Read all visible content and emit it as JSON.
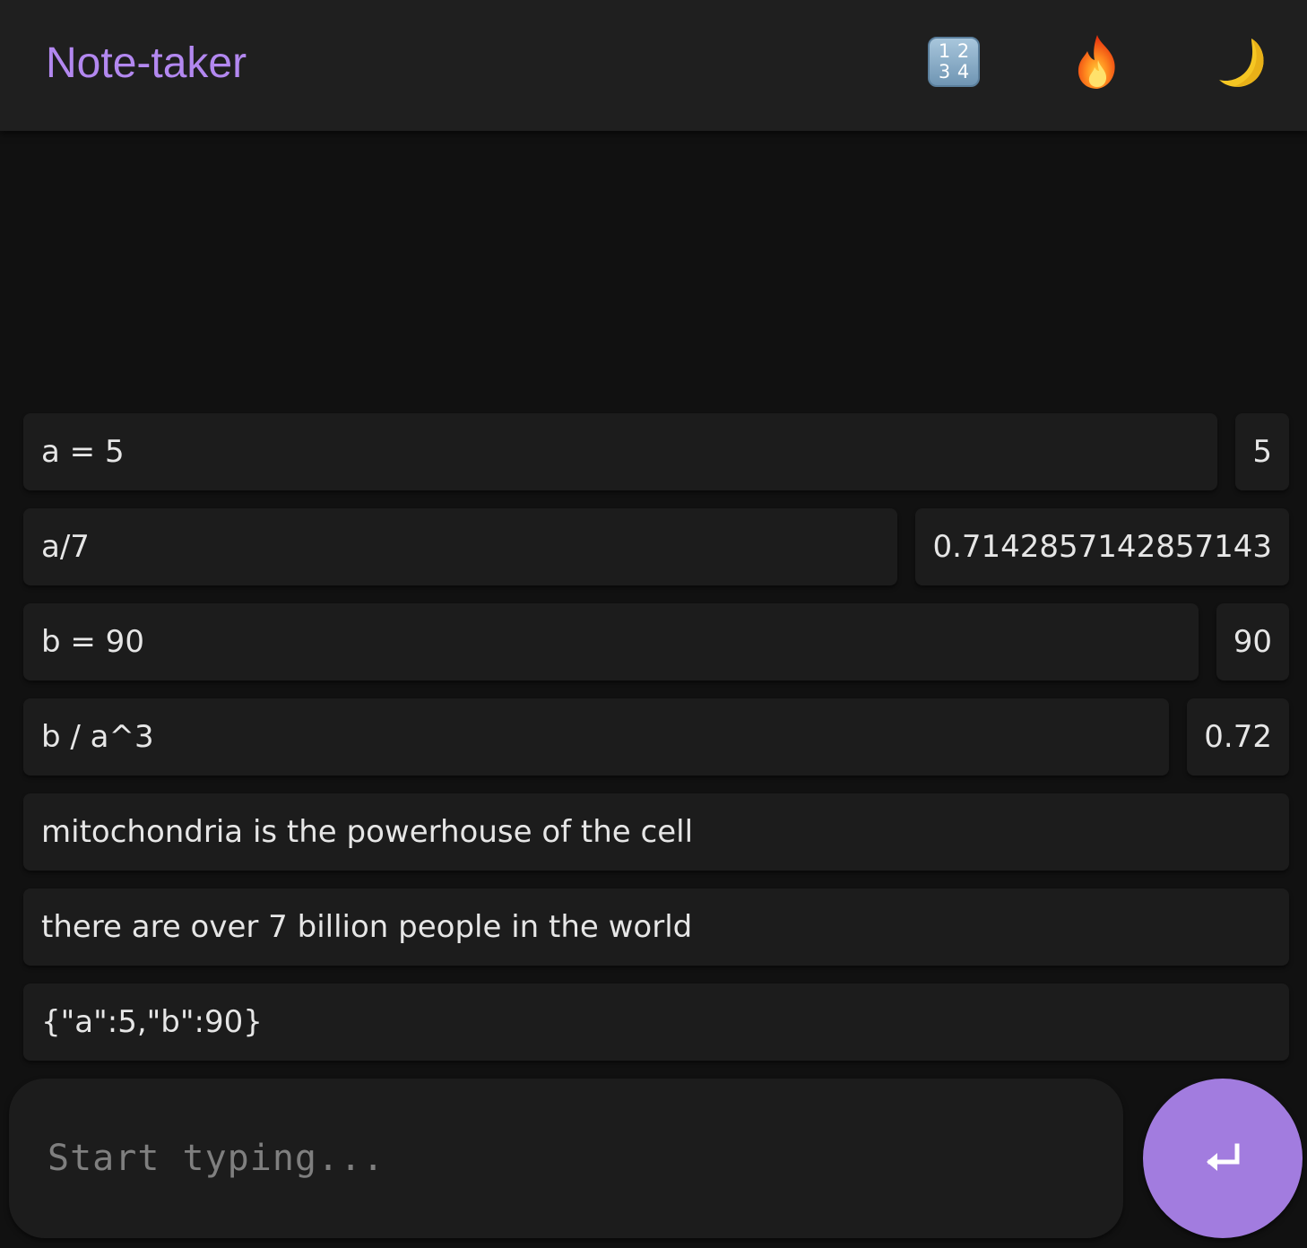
{
  "header": {
    "title": "Note-taker",
    "buttons": [
      {
        "icon": "input-numbers-icon",
        "digits": [
          "1",
          "2",
          "3",
          "4"
        ]
      },
      {
        "icon": "fire-icon"
      },
      {
        "icon": "crescent-moon-icon"
      }
    ]
  },
  "colors": {
    "accent": "#b388f0",
    "send_button": "#a27cdf",
    "background": "#111111",
    "header": "#1f1f1f",
    "cell": "#1c1c1c"
  },
  "notes": [
    {
      "expression": "a = 5",
      "result": "5"
    },
    {
      "expression": "a/7",
      "result": "0.7142857142857143"
    },
    {
      "expression": "b = 90",
      "result": "90"
    },
    {
      "expression": "b / a^3",
      "result": "0.72"
    },
    {
      "expression": "mitochondria is the powerhouse of the cell"
    },
    {
      "expression": "there are over 7 billion people in the world"
    },
    {
      "expression": "{\"a\":5,\"b\":90}"
    }
  ],
  "composer": {
    "placeholder": "Start typing...",
    "value": "",
    "send_icon": "return-arrow-icon"
  }
}
